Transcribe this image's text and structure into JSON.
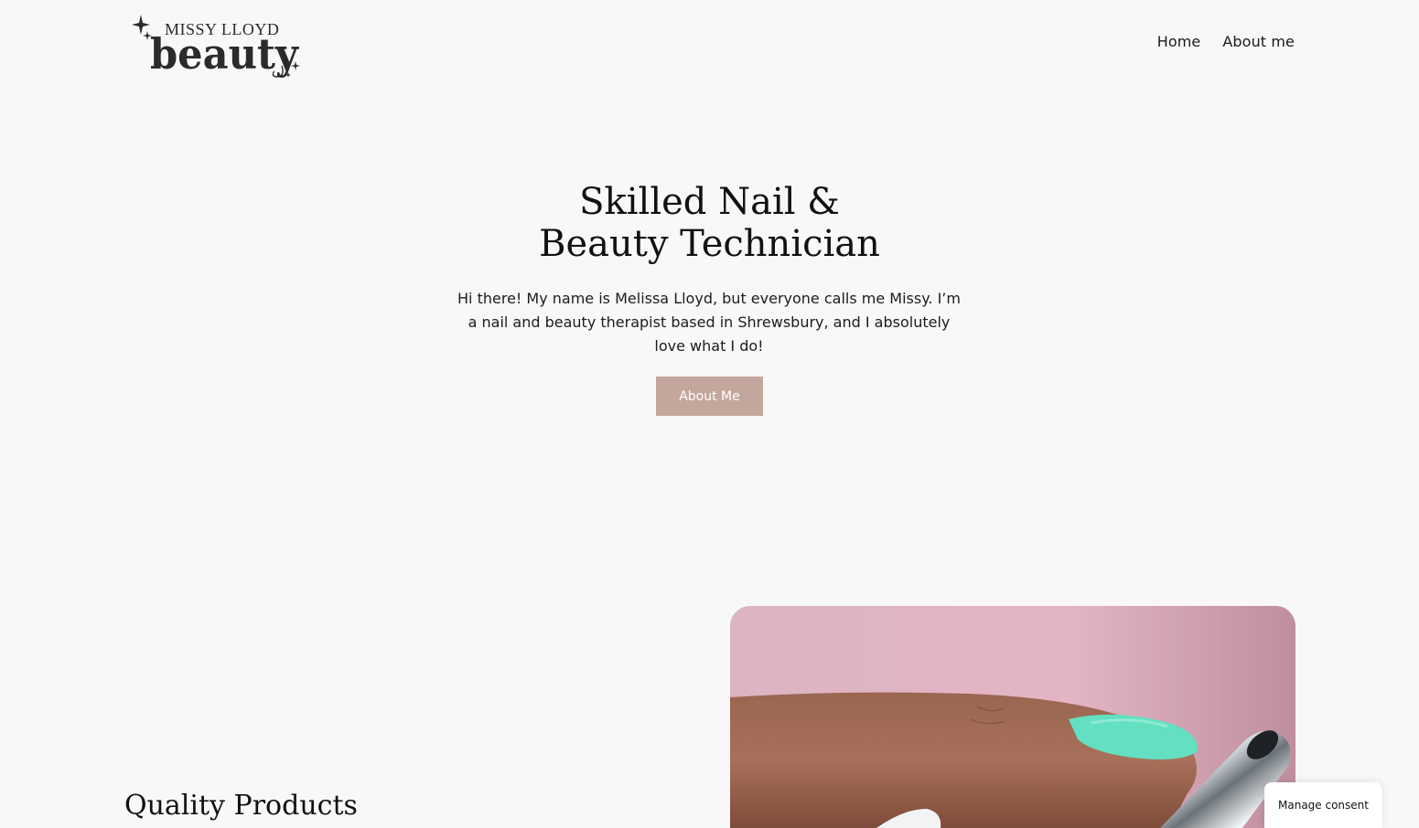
{
  "header": {
    "logo_top_text": "MISSY LLOYD",
    "logo_main_text": "beauty",
    "nav": [
      {
        "label": "Home"
      },
      {
        "label": "About me"
      }
    ]
  },
  "hero": {
    "title": "Skilled Nail & Beauty Technician",
    "text": "Hi there! My name is Melissa Lloyd, but everyone calls me Missy. I’m a nail and beauty therapist based in Shrewsbury, and I absolutely love what I do!",
    "button_label": "About Me"
  },
  "section": {
    "heading": "Quality Products"
  },
  "consent": {
    "button_label": "Manage consent"
  },
  "colors": {
    "background": "#f8f8f8",
    "accent_button": "#c4a79c",
    "photo_backdrop": "#d9a9b9",
    "nail_color": "#62e0c1"
  }
}
